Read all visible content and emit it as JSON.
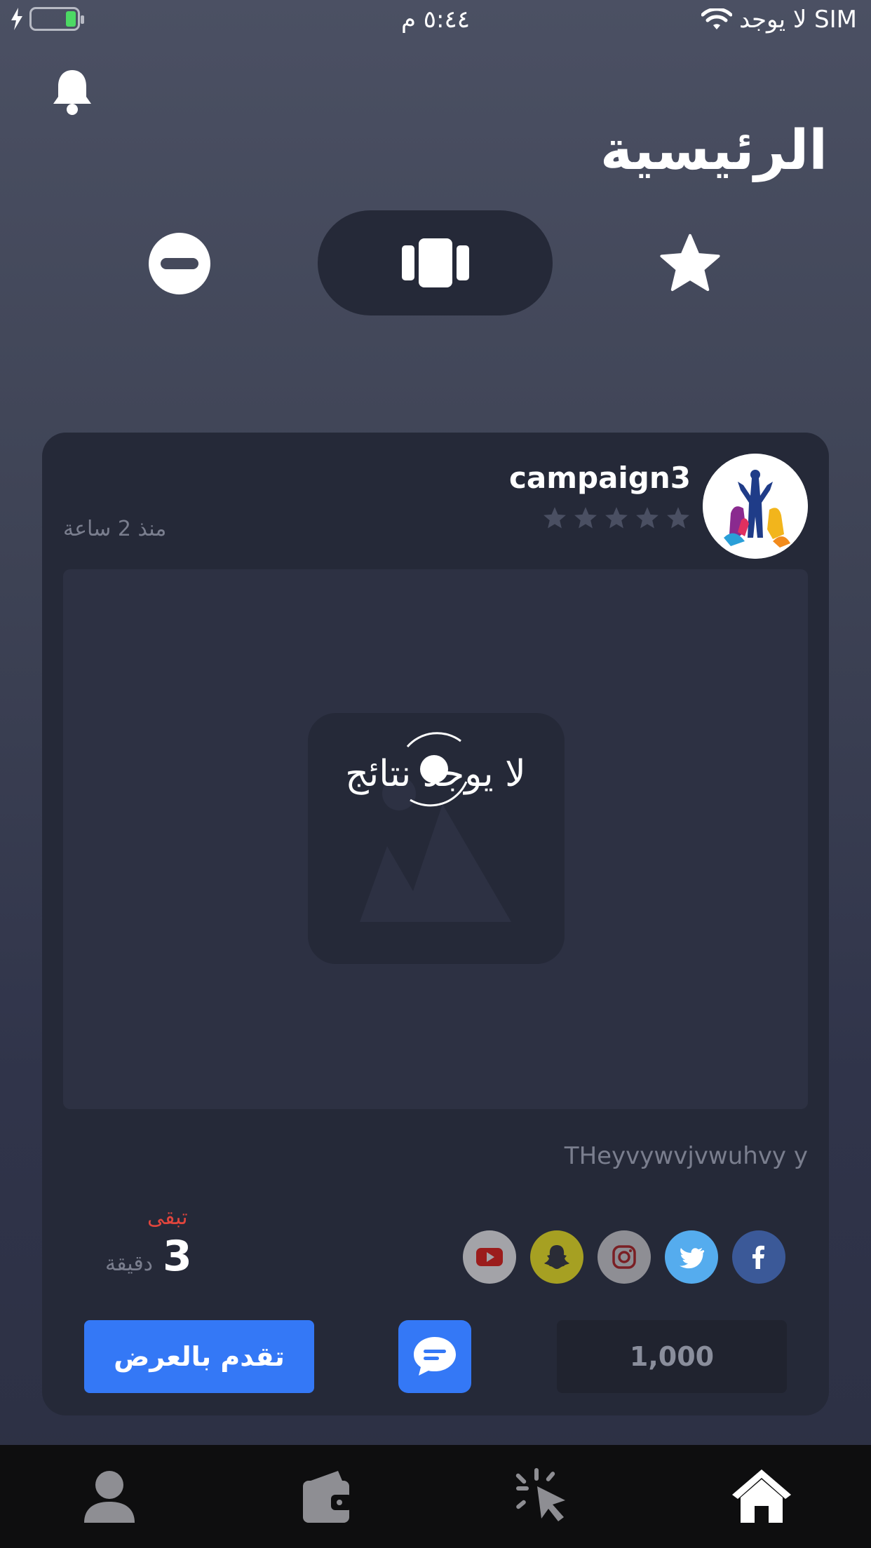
{
  "status_bar": {
    "time": "٥:٤٤ م",
    "carrier": "لا يوجد SIM"
  },
  "header": {
    "title": "الرئيسية"
  },
  "card": {
    "campaign_name": "campaign3",
    "rating": 0,
    "time_ago": "منذ 2 ساعة",
    "no_results": "لا يوجد نتائج",
    "description": "THeyvywvjvwuhvy y",
    "remaining_label": "تبقى",
    "remaining_value": "3",
    "remaining_unit": "دقيقة",
    "apply_label": "تقدم بالعرض",
    "price": "1,000",
    "socials": [
      "youtube-icon",
      "snapchat-icon",
      "instagram-icon",
      "twitter-icon",
      "facebook-icon"
    ]
  },
  "colors": {
    "accent": "#3478f6",
    "card_bg": "#252938",
    "remaining": "#e0453d",
    "facebook": "#3b5998",
    "twitter": "#55acee",
    "instagram": "#8e8e94",
    "snapchat": "#a6a022",
    "youtube": "#a3a3a8"
  },
  "tabbar": {
    "items": [
      "profile-icon",
      "wallet-icon",
      "click-icon",
      "home-icon"
    ],
    "active": "home-icon"
  }
}
